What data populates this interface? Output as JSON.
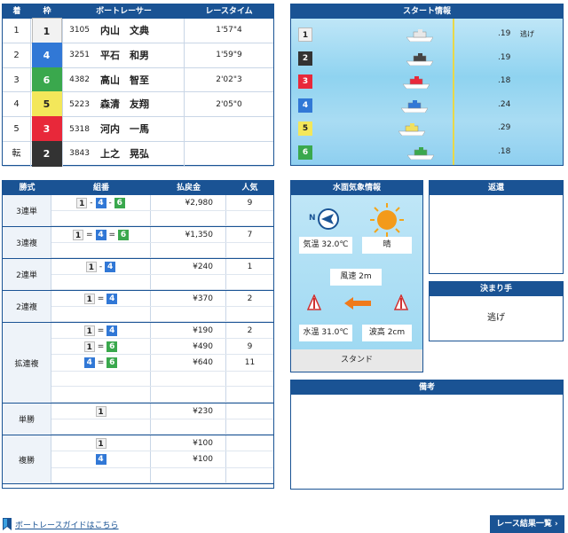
{
  "results": {
    "headers": {
      "rank": "着",
      "frame": "枠",
      "racer": "ボートレーサー",
      "time": "レースタイム"
    },
    "rows": [
      {
        "rank": "1",
        "frame": "1",
        "reg": "3105",
        "name": "内山　文典",
        "time": "1'57\"4"
      },
      {
        "rank": "2",
        "frame": "4",
        "reg": "3251",
        "name": "平石　和男",
        "time": "1'59\"9"
      },
      {
        "rank": "3",
        "frame": "6",
        "reg": "4382",
        "name": "高山　智至",
        "time": "2'02\"3"
      },
      {
        "rank": "4",
        "frame": "5",
        "reg": "5223",
        "name": "森清　友翔",
        "time": "2'05\"0"
      },
      {
        "rank": "5",
        "frame": "3",
        "reg": "5318",
        "name": "河内　一馬",
        "time": ""
      },
      {
        "rank": "転",
        "frame": "2",
        "reg": "3843",
        "name": "上之　晃弘",
        "time": ""
      }
    ]
  },
  "start": {
    "title": "スタート情報",
    "rows": [
      {
        "frame": "1",
        "time": ".19",
        "note": "逃げ"
      },
      {
        "frame": "2",
        "time": ".19",
        "note": ""
      },
      {
        "frame": "3",
        "time": ".18",
        "note": ""
      },
      {
        "frame": "4",
        "time": ".24",
        "note": ""
      },
      {
        "frame": "5",
        "time": ".29",
        "note": ""
      },
      {
        "frame": "6",
        "time": ".18",
        "note": ""
      }
    ]
  },
  "payout": {
    "headers": {
      "type": "勝式",
      "combo": "組番",
      "amount": "払戻金",
      "pop": "人気"
    },
    "groups": [
      {
        "type": "3連単",
        "rows": [
          {
            "combo": [
              "1",
              "4",
              "6"
            ],
            "sep": "-",
            "amount": "¥2,980",
            "pop": "9"
          }
        ]
      },
      {
        "type": "3連複",
        "rows": [
          {
            "combo": [
              "1",
              "4",
              "6"
            ],
            "sep": "=",
            "amount": "¥1,350",
            "pop": "7"
          }
        ]
      },
      {
        "type": "2連単",
        "rows": [
          {
            "combo": [
              "1",
              "4"
            ],
            "sep": "-",
            "amount": "¥240",
            "pop": "1"
          }
        ]
      },
      {
        "type": "2連複",
        "rows": [
          {
            "combo": [
              "1",
              "4"
            ],
            "sep": "=",
            "amount": "¥370",
            "pop": "2"
          }
        ]
      },
      {
        "type": "拡連複",
        "rows": [
          {
            "combo": [
              "1",
              "4"
            ],
            "sep": "=",
            "amount": "¥190",
            "pop": "2"
          },
          {
            "combo": [
              "1",
              "6"
            ],
            "sep": "=",
            "amount": "¥490",
            "pop": "9"
          },
          {
            "combo": [
              "4",
              "6"
            ],
            "sep": "=",
            "amount": "¥640",
            "pop": "11"
          }
        ]
      },
      {
        "type": "単勝",
        "rows": [
          {
            "combo": [
              "1"
            ],
            "sep": "",
            "amount": "¥230",
            "pop": ""
          }
        ]
      },
      {
        "type": "複勝",
        "rows": [
          {
            "combo": [
              "1"
            ],
            "sep": "",
            "amount": "¥100",
            "pop": ""
          },
          {
            "combo": [
              "4"
            ],
            "sep": "",
            "amount": "¥100",
            "pop": ""
          }
        ]
      }
    ]
  },
  "weather": {
    "title": "水面気象情報",
    "air_temp": "気温 32.0℃",
    "condition": "晴",
    "wind_speed": "風速 2m",
    "water_temp": "水温 31.0℃",
    "wave": "波高 2cm",
    "stand": "スタンド",
    "north": "N"
  },
  "refund": {
    "title": "返還"
  },
  "kimarite": {
    "title": "決まり手",
    "value": "逃げ"
  },
  "remarks": {
    "title": "備考"
  },
  "footer": {
    "guide_link": "ボートレースガイドはこちら",
    "results_button": "レース結果一覧"
  }
}
